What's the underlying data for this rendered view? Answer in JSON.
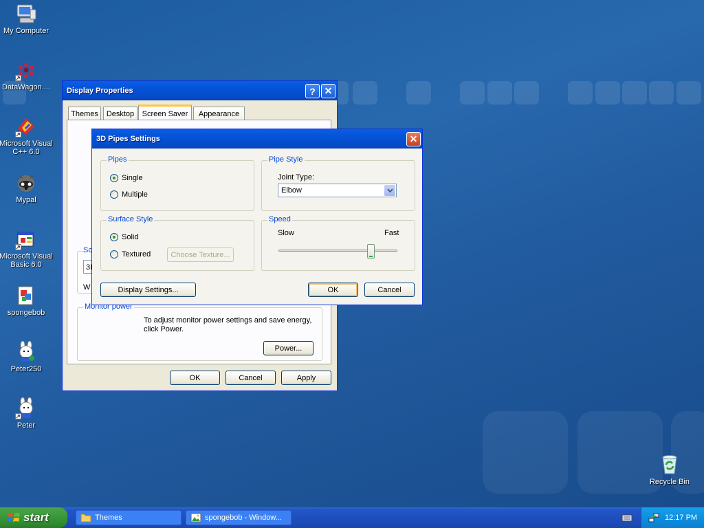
{
  "desktop_icons": [
    {
      "label": "My Computer",
      "icon": "my-computer-icon",
      "shortcut": false
    },
    {
      "label": "DataWagon....",
      "icon": "datawagon-icon",
      "shortcut": true
    },
    {
      "label": "Microsoft Visual C++ 6.0",
      "icon": "visual-cpp-icon",
      "shortcut": true
    },
    {
      "label": "Mypal",
      "icon": "mypal-icon",
      "shortcut": false
    },
    {
      "label": "Microsoft Visual Basic 6.0",
      "icon": "visual-basic-icon",
      "shortcut": true
    },
    {
      "label": "spongebob",
      "icon": "spongebob-icon",
      "shortcut": false
    },
    {
      "label": "Peter250",
      "icon": "peter250-icon",
      "shortcut": false
    },
    {
      "label": "Peter",
      "icon": "peter-icon",
      "shortcut": true
    },
    {
      "label": "Recycle Bin",
      "icon": "recycle-bin-icon",
      "shortcut": false
    }
  ],
  "display_properties": {
    "title": "Display Properties",
    "help_glyph": "?",
    "close_glyph": "✕",
    "tabs": [
      "Themes",
      "Desktop",
      "Screen Saver",
      "Appearance"
    ],
    "active_tab": "Screen Saver",
    "screensaver_group_label": "Sc",
    "screensaver_value": "3D",
    "wait_label": "W",
    "monitor_group_label": "Monitor power",
    "monitor_text": "To adjust monitor power settings and save energy, click Power.",
    "power_button": "Power...",
    "ok": "OK",
    "cancel": "Cancel",
    "apply": "Apply"
  },
  "pipes_settings": {
    "title": "3D Pipes Settings",
    "close_glyph": "✕",
    "pipes_group": "Pipes",
    "pipes_options": [
      "Single",
      "Multiple"
    ],
    "pipes_selected": "Single",
    "surface_group": "Surface Style",
    "surface_options": [
      "Solid",
      "Textured"
    ],
    "surface_selected": "Solid",
    "choose_texture": "Choose Texture...",
    "pipe_style_group": "Pipe Style",
    "joint_type_label": "Joint Type:",
    "joint_type_value": "Elbow",
    "speed_group": "Speed",
    "speed_slow": "Slow",
    "speed_fast": "Fast",
    "speed_level": 0.8,
    "display_settings_button": "Display Settings...",
    "ok": "OK",
    "cancel": "Cancel"
  },
  "taskbar": {
    "start_label": "start",
    "tasks": [
      {
        "label": "Themes",
        "icon": "folder-icon"
      },
      {
        "label": "spongebob - Window...",
        "icon": "picture-viewer-icon"
      }
    ],
    "clock": "12:17 PM"
  },
  "colors": {
    "desktop": "#2462a8",
    "titlebar": "#0553d6",
    "close_button": "#c8401e",
    "start_button": "#3c9a3c",
    "tray": "#0e8fe0",
    "group_label": "#0046d5"
  }
}
